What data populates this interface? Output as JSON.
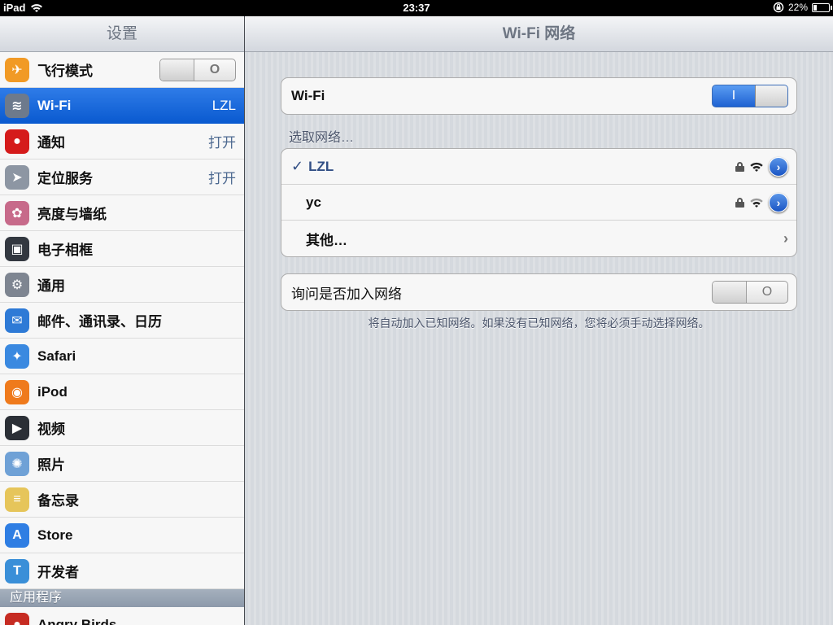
{
  "status_bar": {
    "device": "iPad",
    "time": "23:37",
    "battery": "22%",
    "battery_level": 0.22
  },
  "sidebar": {
    "title": "设置",
    "items": [
      {
        "label": "飞行模式",
        "value": "",
        "icon": "airplane-icon",
        "color": "#f19a25",
        "toggle": "O"
      },
      {
        "label": "Wi-Fi",
        "value": "LZL",
        "icon": "wifi-icon",
        "color": "#6d7a8c"
      },
      {
        "label": "通知",
        "value": "打开",
        "icon": "notifications-icon",
        "color": "#d51b1b"
      },
      {
        "label": "定位服务",
        "value": "打开",
        "icon": "location-icon",
        "color": "#8d96a3"
      },
      {
        "label": "亮度与墙纸",
        "value": "",
        "icon": "brightness-wallpaper-icon",
        "color": "#c76a8a"
      },
      {
        "label": "电子相框",
        "value": "",
        "icon": "picture-frame-icon",
        "color": "#333840"
      },
      {
        "label": "通用",
        "value": "",
        "icon": "gear-icon",
        "color": "#7e8591"
      },
      {
        "label": "邮件、通讯录、日历",
        "value": "",
        "icon": "mail-icon",
        "color": "#2e7ad6"
      },
      {
        "label": "Safari",
        "value": "",
        "icon": "safari-compass-icon",
        "color": "#3a89e0"
      },
      {
        "label": "iPod",
        "value": "",
        "icon": "ipod-icon",
        "color": "#ef7a1c"
      },
      {
        "label": "视频",
        "value": "",
        "icon": "video-clapper-icon",
        "color": "#2b2f36"
      },
      {
        "label": "照片",
        "value": "",
        "icon": "photos-sunflower-icon",
        "color": "#6fa1d6"
      },
      {
        "label": "备忘录",
        "value": "",
        "icon": "notes-icon",
        "color": "#e6c55a"
      },
      {
        "label": "Store",
        "value": "",
        "icon": "app-store-icon",
        "color": "#2f7ee3"
      },
      {
        "label": "开发者",
        "value": "",
        "icon": "developer-hammer-icon",
        "color": "#3a8fd8"
      }
    ],
    "section_header": "应用程序",
    "app_items": [
      {
        "label": "Angry Birds",
        "icon": "angry-birds-icon",
        "color": "#c62b22"
      }
    ]
  },
  "main": {
    "title": "Wi-Fi 网络",
    "wifi_row": {
      "label": "Wi-Fi",
      "toggle": "I"
    },
    "choose_network": "选取网络…",
    "networks": [
      {
        "name": "LZL",
        "selected": true,
        "check": "✓"
      },
      {
        "name": "yc",
        "selected": false
      }
    ],
    "other_label": "其他…",
    "ask_row": {
      "label": "询问是否加入网络",
      "toggle": "O"
    },
    "footnote": "将自动加入已知网络。如果没有已知网络，您将必须手动选择网络。"
  }
}
